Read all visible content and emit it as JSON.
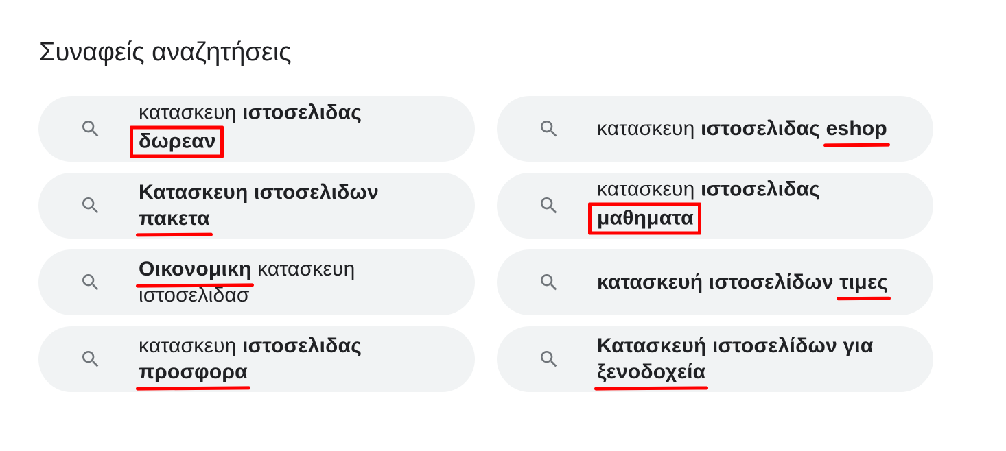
{
  "section": {
    "title": "Συναφείς αναζητήσεις"
  },
  "suggestions": [
    {
      "line1_plain": "κατασκευη ",
      "line1_bold": "ιστοσελιδας",
      "line2_bold": "δωρεαν",
      "annotation": "box"
    },
    {
      "plain": "κατασκευη ",
      "bold": "ιστοσελιδας ",
      "bold_marked": "eshop",
      "annotation": "underline"
    },
    {
      "line1_bold": "Κατασκευη ιστοσελιδων",
      "line2_bold": "πακετα",
      "annotation": "underline"
    },
    {
      "line1_plain": "κατασκευη ",
      "line1_bold": "ιστοσελιδας",
      "line2_bold": "μαθηματα",
      "annotation": "box"
    },
    {
      "line1_bold": "Οικονομικη",
      "line1_plain": " κατασκευη",
      "line2_plain": "ιστοσελιδασ",
      "annotation": "underline"
    },
    {
      "bold": "κατασκευή ιστοσελίδων ",
      "bold_marked": "τιμες",
      "annotation": "underline"
    },
    {
      "line1_plain": "κατασκευη ",
      "line1_bold": "ιστοσελιδας",
      "line2_bold": "προσφορα",
      "annotation": "underline"
    },
    {
      "line1_bold": "Κατασκευή ιστοσελίδων για",
      "line2_bold": "ξενοδοχεία",
      "annotation": "underline"
    }
  ],
  "icons": {
    "search": "search-icon"
  },
  "colors": {
    "pill_background": "#f1f3f4",
    "text": "#202124",
    "icon": "#70757a",
    "annotation": "#ff0000"
  }
}
